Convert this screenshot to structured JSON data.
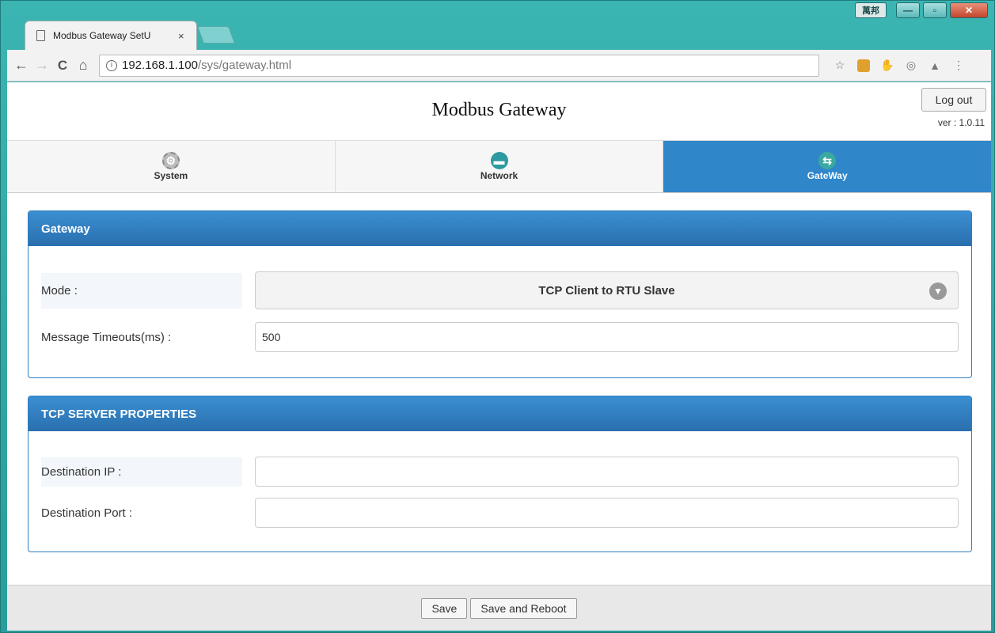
{
  "browser": {
    "tab_title": "Modbus Gateway SetU",
    "tab_close": "×",
    "url_host": "192.168.1.100",
    "url_path": "/sys/gateway.html",
    "ime_label": "萬邦",
    "back": "←",
    "forward": "→",
    "reload": "C",
    "home": "⌂",
    "star": "☆",
    "menu": "⋮"
  },
  "header": {
    "title": "Modbus Gateway",
    "logout_label": "Log out",
    "version": "ver : 1.0.11"
  },
  "nav": {
    "tabs": [
      {
        "label": "System",
        "icon": "gear-icon"
      },
      {
        "label": "Network",
        "icon": "network-icon"
      },
      {
        "label": "GateWay",
        "icon": "gateway-icon"
      }
    ]
  },
  "gateway_panel": {
    "title": "Gateway",
    "mode_label": "Mode :",
    "mode_value": "TCP Client to RTU Slave",
    "timeout_label": "Message Timeouts(ms) :",
    "timeout_value": "500"
  },
  "tcp_panel": {
    "title": "TCP SERVER PROPERTIES",
    "dest_ip_label": "Destination IP :",
    "dest_ip_value": "",
    "dest_port_label": "Destination Port :",
    "dest_port_value": ""
  },
  "footer": {
    "save_label": "Save",
    "save_reboot_label": "Save and Reboot"
  },
  "colors": {
    "accent": "#2f86c9",
    "panel_header": "#2a6fae"
  }
}
